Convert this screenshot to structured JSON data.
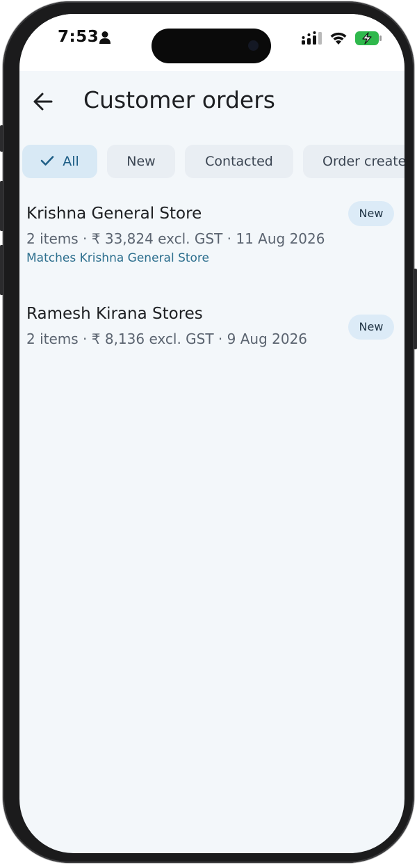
{
  "status_bar": {
    "time": "7:53",
    "icons": [
      "person-icon",
      "cellular-signal-icon",
      "wifi-icon",
      "battery-charging-icon"
    ]
  },
  "app_bar": {
    "title": "Customer orders",
    "back_icon": "arrow-back-icon"
  },
  "filters": [
    {
      "label": "All",
      "selected": true
    },
    {
      "label": "New",
      "selected": false
    },
    {
      "label": "Contacted",
      "selected": false
    },
    {
      "label": "Order create",
      "selected": false
    }
  ],
  "orders": [
    {
      "customer": "Krishna General Store",
      "details": "2 items · ₹ 33,824 excl. GST · 11 Aug 2026",
      "match": "Matches Krishna General Store",
      "status": "New"
    },
    {
      "customer": "Ramesh Kirana Stores",
      "details": "2 items · ₹ 8,136 excl. GST · 9 Aug 2026",
      "status": "New"
    }
  ],
  "colors": {
    "background": "#f3f7fa",
    "chip_selected": "#d8e9f5",
    "chip": "#e9eef3",
    "badge": "#dcebf7",
    "accent_text": "#2d6f8e"
  }
}
